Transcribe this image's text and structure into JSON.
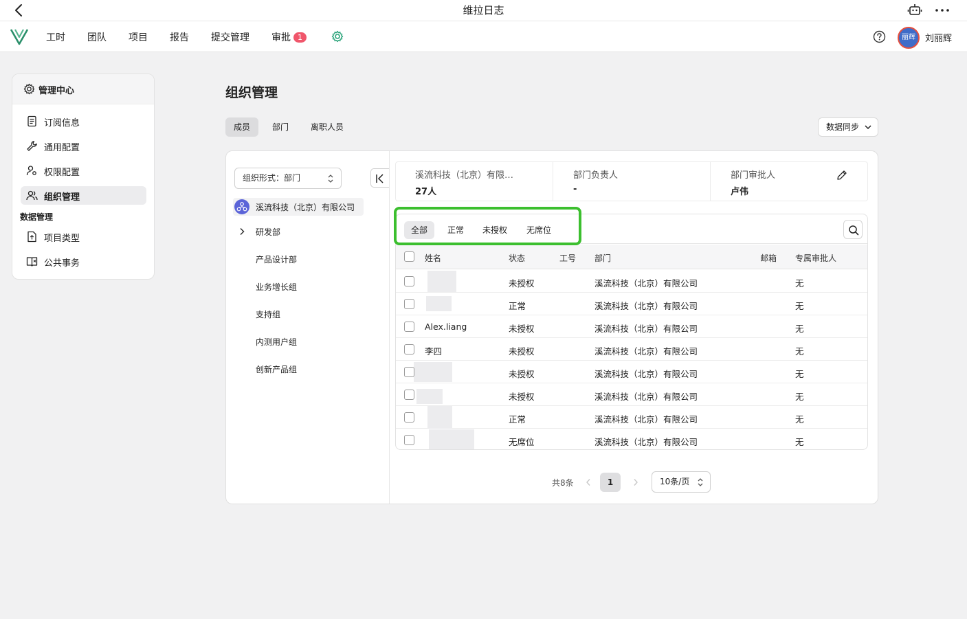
{
  "app": {
    "title": "维拉日志"
  },
  "nav": {
    "items": [
      "工时",
      "团队",
      "项目",
      "报告",
      "提交管理"
    ],
    "approval_label": "审批",
    "approval_badge": "1",
    "user_name": "刘丽辉",
    "avatar_text": "丽辉"
  },
  "sidebar": {
    "header": "管理中心",
    "items": [
      {
        "label": "订阅信息",
        "icon": "document-icon"
      },
      {
        "label": "通用配置",
        "icon": "wrench-icon"
      },
      {
        "label": "权限配置",
        "icon": "user-key-icon"
      },
      {
        "label": "组织管理",
        "icon": "users-icon"
      }
    ],
    "group_label": "数据管理",
    "group_items": [
      {
        "label": "项目类型",
        "icon": "file-upload-icon"
      },
      {
        "label": "公共事务",
        "icon": "book-icon"
      }
    ],
    "active": "组织管理"
  },
  "page": {
    "title": "组织管理",
    "tabs": [
      "成员",
      "部门",
      "离职人员"
    ],
    "active_tab": "成员",
    "sync_button": "数据同步"
  },
  "org": {
    "select_value": "组织形式：部门",
    "company": "溪流科技（北京）有限公司",
    "departments": [
      "研发部",
      "产品设计部",
      "业务增长组",
      "支持组",
      "内测用户组",
      "创新产品组"
    ]
  },
  "summary": {
    "company_short": "溪流科技（北京）有限…",
    "count": "27人",
    "head_label": "部门负责人",
    "head_value": "-",
    "approver_label": "部门审批人",
    "approver_value": "卢伟"
  },
  "filters": {
    "tabs": [
      "全部",
      "正常",
      "未授权",
      "无席位"
    ],
    "active": "全部"
  },
  "table": {
    "columns": [
      "姓名",
      "状态",
      "工号",
      "部门",
      "邮箱",
      "专属审批人"
    ],
    "rows": [
      {
        "name": "",
        "status": "未授权",
        "dept": "溪流科技（北京）有限公司",
        "approver": "无"
      },
      {
        "name": "",
        "status": "正常",
        "dept": "溪流科技（北京）有限公司",
        "approver": "无"
      },
      {
        "name": "Alex.liang",
        "status": "未授权",
        "dept": "溪流科技（北京）有限公司",
        "approver": "无"
      },
      {
        "name": "李四",
        "status": "未授权",
        "dept": "溪流科技（北京）有限公司",
        "approver": "无"
      },
      {
        "name": "",
        "status": "未授权",
        "dept": "溪流科技（北京）有限公司",
        "approver": "无"
      },
      {
        "name": "",
        "status": "未授权",
        "dept": "溪流科技（北京）有限公司",
        "approver": "无"
      },
      {
        "name": "",
        "status": "正常",
        "dept": "溪流科技（北京）有限公司",
        "approver": "无"
      },
      {
        "name": "",
        "status": "无席位",
        "dept": "溪流科技（北京）有限公司",
        "approver": "无"
      }
    ]
  },
  "pagination": {
    "total": "共8条",
    "current_page": "1",
    "page_size": "10条/页"
  },
  "colors": {
    "accent_green": "#3cbf2f",
    "badge_red": "#f0566b",
    "logo_green": "#2a8f6a"
  }
}
